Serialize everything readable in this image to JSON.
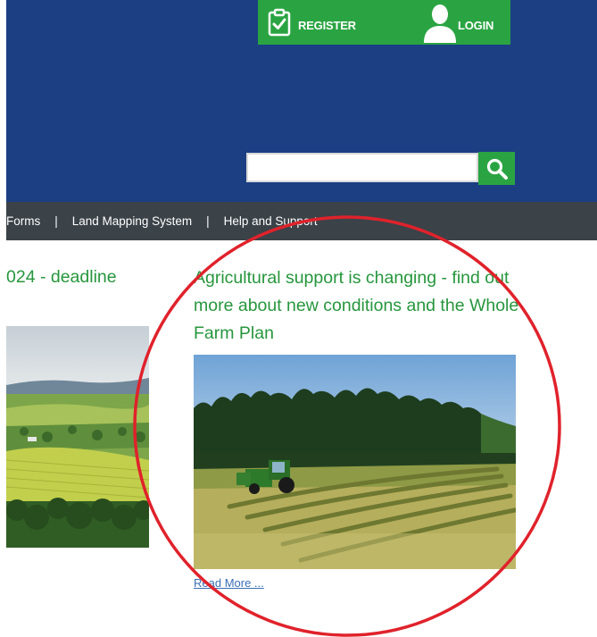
{
  "header": {
    "register_label": "REGISTER",
    "login_label": "LOGIN",
    "search": {
      "value": ""
    }
  },
  "nav": {
    "items": [
      "Forms",
      "Land Mapping System",
      "Help and Support"
    ],
    "separator": "|"
  },
  "cards": [
    {
      "title": "024 - deadline"
    },
    {
      "title": "Agricultural support is changing - find out more about new conditions and the Whole Farm Plan",
      "read_more": "Read More ..."
    }
  ],
  "colors": {
    "header_bg": "#1c3f84",
    "accent_green": "#2aa442",
    "nav_bg": "#3b4248",
    "title_green": "#27963d",
    "link_blue": "#3a6fb6",
    "annotation_red": "#e0222b"
  }
}
